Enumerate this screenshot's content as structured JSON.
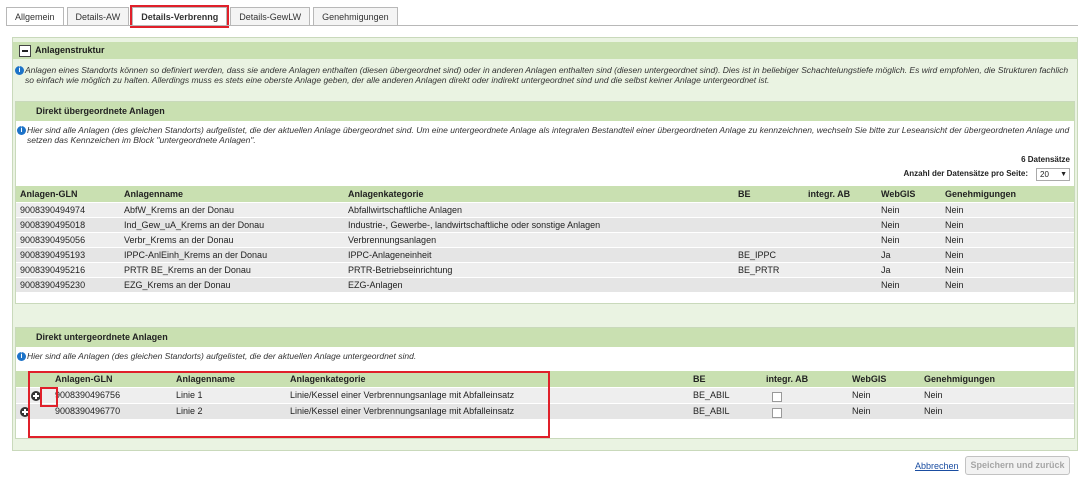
{
  "tabs": [
    {
      "label": "Allgemein"
    },
    {
      "label": "Details-AW"
    },
    {
      "label": "Details-Verbrenng"
    },
    {
      "label": "Details-GewLW"
    },
    {
      "label": "Genehmigungen"
    }
  ],
  "section": {
    "title": "Anlagenstruktur",
    "info": "Anlagen eines Standorts können so definiert werden, dass sie andere Anlagen enthalten (diesen übergeordnet sind) oder in anderen Anlagen enthalten sind (diesen untergeordnet sind). Dies ist in beliebiger Schachtelungstiefe möglich. Es wird empfohlen, die Strukturen fachlich so einfach wie möglich zu halten. Allerdings muss es stets eine oberste Anlage geben, der alle anderen Anlagen direkt oder indirekt untergeordnet sind und die selbst keiner Anlage untergeordnet ist."
  },
  "parents": {
    "title": "Direkt übergeordnete Anlagen",
    "info": "Hier sind alle Anlagen (des gleichen Standorts) aufgelistet, die der aktuellen Anlage übergeordnet sind. Um eine untergeordnete Anlage als integralen Bestandteil einer übergeordneten Anlage zu kennzeichnen, wechseln Sie bitte zur Leseansicht der übergeordneten Anlage und setzen das Kennzeichen im Block \"untergeordnete Anlagen\".",
    "record_count": "6 Datensätze",
    "per_page_label": "Anzahl der Datensätze pro Seite:",
    "per_page_value": "20",
    "columns": [
      "Anlagen-GLN",
      "Anlagenname",
      "Anlagenkategorie",
      "BE",
      "integr. AB",
      "WebGIS",
      "Genehmigungen"
    ],
    "rows": [
      {
        "gln": "9008390494974",
        "name": "AbfW_Krems an der Donau",
        "cat": "Abfallwirtschaftliche Anlagen",
        "be": "",
        "integr": "",
        "webgis": "Nein",
        "gen": "Nein"
      },
      {
        "gln": "9008390495018",
        "name": "Ind_Gew_uA_Krems an der Donau",
        "cat": "Industrie-, Gewerbe-, landwirtschaftliche oder sonstige Anlagen",
        "be": "",
        "integr": "",
        "webgis": "Nein",
        "gen": "Nein"
      },
      {
        "gln": "9008390495056",
        "name": "Verbr_Krems an der Donau",
        "cat": "Verbrennungsanlagen",
        "be": "",
        "integr": "",
        "webgis": "Nein",
        "gen": "Nein"
      },
      {
        "gln": "9008390495193",
        "name": "IPPC-AnlEinh_Krems an der Donau",
        "cat": "IPPC-Anlageneinheit",
        "be": "BE_IPPC",
        "integr": "",
        "webgis": "Ja",
        "gen": "Nein"
      },
      {
        "gln": "9008390495216",
        "name": "PRTR BE_Krems an der Donau",
        "cat": "PRTR-Betriebseinrichtung",
        "be": "BE_PRTR",
        "integr": "",
        "webgis": "Ja",
        "gen": "Nein"
      },
      {
        "gln": "9008390495230",
        "name": "EZG_Krems an der Donau",
        "cat": "EZG-Anlagen",
        "be": "",
        "integr": "",
        "webgis": "Nein",
        "gen": "Nein"
      }
    ]
  },
  "children": {
    "title": "Direkt untergeordnete Anlagen",
    "info": "Hier sind alle Anlagen (des gleichen Standorts) aufgelistet, die der aktuellen Anlage untergeordnet sind.",
    "columns": [
      "Anlagen-GLN",
      "Anlagenname",
      "Anlagenkategorie",
      "BE",
      "integr. AB",
      "WebGIS",
      "Genehmigungen"
    ],
    "rows": [
      {
        "gln": "9008390496756",
        "name": "Linie 1",
        "cat": "Linie/Kessel einer Verbrennungsanlage mit Abfalleinsatz",
        "be": "BE_ABIL",
        "webgis": "Nein",
        "gen": "Nein"
      },
      {
        "gln": "9008390496770",
        "name": "Linie 2",
        "cat": "Linie/Kessel einer Verbrennungsanlage mit Abfalleinsatz",
        "be": "BE_ABIL",
        "webgis": "Nein",
        "gen": "Nein"
      }
    ]
  },
  "footer": {
    "cancel": "Abbrechen",
    "save": "Speichern und zurück"
  },
  "colors": {
    "header_green": "#c9e0b1",
    "frame_green": "#eaf3e2",
    "highlight_red": "#e0202a",
    "link_blue": "#1a4da1"
  }
}
